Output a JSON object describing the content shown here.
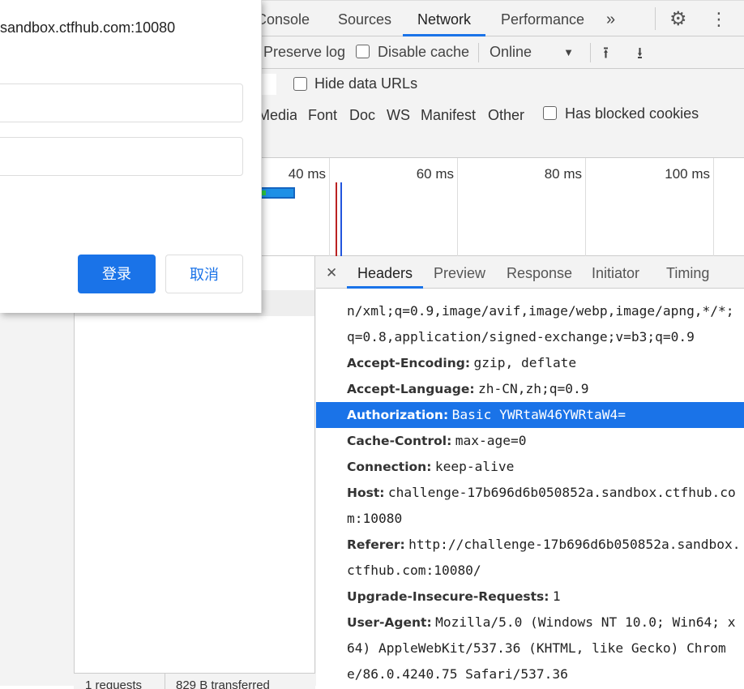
{
  "devtools": {
    "tabs": [
      "Console",
      "Sources",
      "Network",
      "Performance"
    ],
    "active_tab": "Network",
    "more_tabs_icon": "chevron-double-right-icon",
    "toolbar": {
      "preserve_log": "Preserve log",
      "disable_cache": "Disable cache",
      "throttle": "Online"
    },
    "filter": {
      "hide_data_urls": "Hide data URLs"
    },
    "types": [
      "Media",
      "Font",
      "Doc",
      "WS",
      "Manifest",
      "Other"
    ],
    "has_blocked_cookies": "Has blocked cookies",
    "timeline_ticks": [
      "40 ms",
      "60 ms",
      "80 ms",
      "100 ms"
    ],
    "status": {
      "requests": "1 requests",
      "transferred": "829 B transferred"
    }
  },
  "details": {
    "tabs": [
      "Headers",
      "Preview",
      "Response",
      "Initiator",
      "Timing"
    ],
    "active_tab": "Headers",
    "lines": [
      {
        "name": "",
        "value": "n/xml;q=0.9,image/avif,image/webp,image/apng,*/*;"
      },
      {
        "name": "",
        "value": "q=0.8,application/signed-exchange;v=b3;q=0.9"
      },
      {
        "name": "Accept-Encoding:",
        "value": "gzip, deflate"
      },
      {
        "name": "Accept-Language:",
        "value": "zh-CN,zh;q=0.9"
      },
      {
        "name": "Authorization:",
        "value": "Basic YWRtaW46YWRtaW4=",
        "selected": true
      },
      {
        "name": "Cache-Control:",
        "value": "max-age=0"
      },
      {
        "name": "Connection:",
        "value": "keep-alive"
      },
      {
        "name": "Host:",
        "value": "challenge-17b696d6b050852a.sandbox.ctfhub.co"
      },
      {
        "name": "",
        "value": "m:10080"
      },
      {
        "name": "Referer:",
        "value": "http://challenge-17b696d6b050852a.sandbox."
      },
      {
        "name": "",
        "value": "ctfhub.com:10080/"
      },
      {
        "name": "Upgrade-Insecure-Requests:",
        "value": "1"
      },
      {
        "name": "User-Agent:",
        "value": "Mozilla/5.0 (Windows NT 10.0; Win64; x"
      },
      {
        "name": "",
        "value": "64) AppleWebKit/537.36 (KHTML, like Gecko) Chrom"
      },
      {
        "name": "",
        "value": "e/86.0.4240.75 Safari/537.36"
      }
    ]
  },
  "dialog": {
    "host": "sandbox.ctfhub.com:10080",
    "login": "登录",
    "cancel": "取消",
    "accent": "#1a73e8"
  }
}
